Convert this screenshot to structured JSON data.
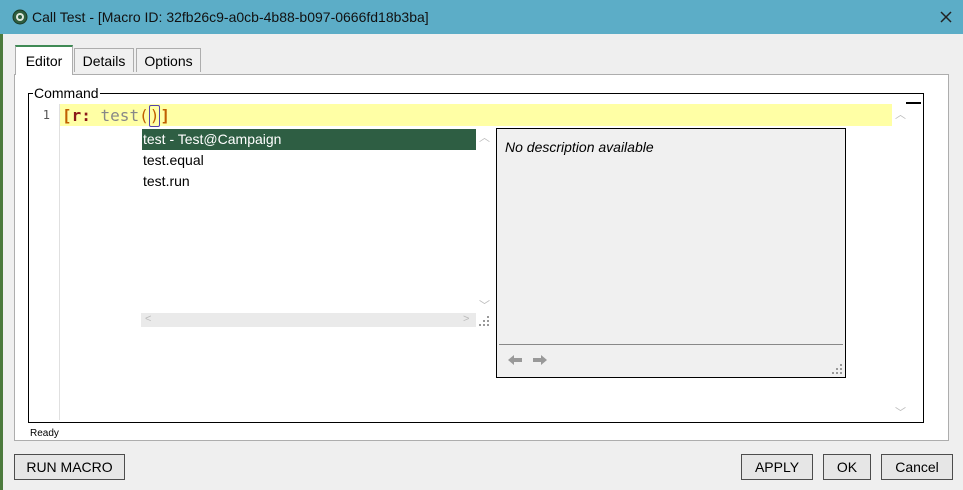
{
  "window": {
    "title": "Call Test - [Macro ID: 32fb26c9-a0cb-4b88-b097-0666fd18b3ba]",
    "icon": "gear-icon",
    "close_label": "×"
  },
  "tabs": [
    {
      "label": "Editor",
      "active": true
    },
    {
      "label": "Details",
      "active": false
    },
    {
      "label": "Options",
      "active": false
    }
  ],
  "command": {
    "group_label": "Command",
    "line_number": "1",
    "code": {
      "open_bracket": "[",
      "keyword": "r:",
      "identifier": " test",
      "open_paren": "(",
      "close_paren": ")",
      "close_bracket": "]"
    }
  },
  "autocomplete": {
    "items": [
      {
        "label": "test - Test@Campaign",
        "selected": true
      },
      {
        "label": "test.equal",
        "selected": false
      },
      {
        "label": "test.run",
        "selected": false
      }
    ],
    "description": "No description available"
  },
  "status": "Ready",
  "buttons": {
    "run_macro": "RUN MACRO",
    "apply": "APPLY",
    "ok": "OK",
    "cancel": "Cancel"
  },
  "colors": {
    "titlebar": "#5cadc7",
    "selection": "#2e5e43",
    "line_highlight": "#ffffa5"
  }
}
